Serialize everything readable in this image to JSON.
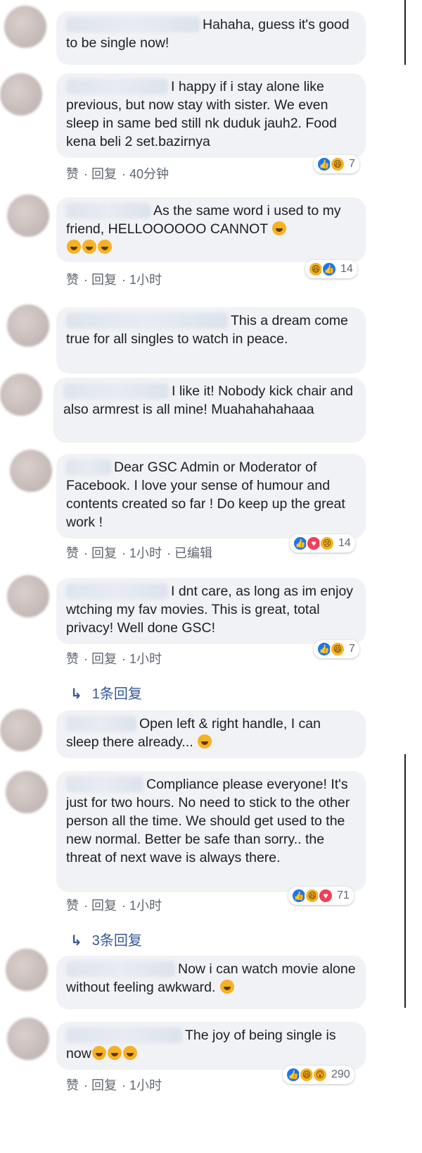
{
  "comments": [
    {
      "text": "Hahaha, guess it's good to be single now!"
    },
    {
      "text": "I happy if i stay alone like previous, but now stay with sister. We even sleep in same bed still nk duduk jauh2. Food kena beli 2 set.bazirnya",
      "meta": [
        "赞",
        "回复",
        "40分钟"
      ],
      "reactions": [
        "like",
        "haha"
      ],
      "count": "7"
    },
    {
      "text": "As the same word i used to my friend, HELLOOOOOO CANNOT",
      "meta": [
        "赞",
        "回复",
        "1小时"
      ],
      "reactions": [
        "haha",
        "like"
      ],
      "count": "14"
    },
    {
      "text": "This a dream come true for all singles to watch in peace."
    },
    {
      "text": "I like it! Nobody kick chair and also armrest is all mine! Muahahahahaaa"
    },
    {
      "text": "Dear GSC Admin or Moderator of Facebook. I love your sense of humour and contents created so far ! Do keep up the great work !",
      "meta": [
        "赞",
        "回复",
        "1小时",
        "已编辑"
      ],
      "reactions": [
        "like",
        "love",
        "sad"
      ],
      "count": "14"
    },
    {
      "text": "I dnt care, as long as im enjoy wtching my fav movies. This is great, total privacy! Well done GSC!",
      "meta": [
        "赞",
        "回复",
        "1小时"
      ],
      "reactions": [
        "like",
        "haha"
      ],
      "count": "7",
      "replies": "1条回复"
    },
    {
      "text": "Open left & right handle, I can sleep there already..."
    },
    {
      "text": "Compliance please everyone! It's just for two hours. No need to stick to the other person all the time. We should get used to the new normal. Better be safe than sorry.. the threat of next wave is always there.",
      "meta": [
        "赞",
        "回复",
        "1小时"
      ],
      "reactions": [
        "like",
        "haha",
        "love"
      ],
      "count": "71",
      "replies": "3条回复"
    },
    {
      "text": "Now i can watch movie alone without feeling awkward."
    },
    {
      "text": "The joy of being single is now",
      "meta": [
        "赞",
        "回复",
        "1小时"
      ],
      "reactions": [
        "like",
        "haha",
        "wow"
      ],
      "count": "290"
    }
  ],
  "colors": {
    "bubble": "#f0f2f5",
    "link": "#365899",
    "like": "#1877f2",
    "love": "#f33e58",
    "haha": "#f7b125"
  }
}
